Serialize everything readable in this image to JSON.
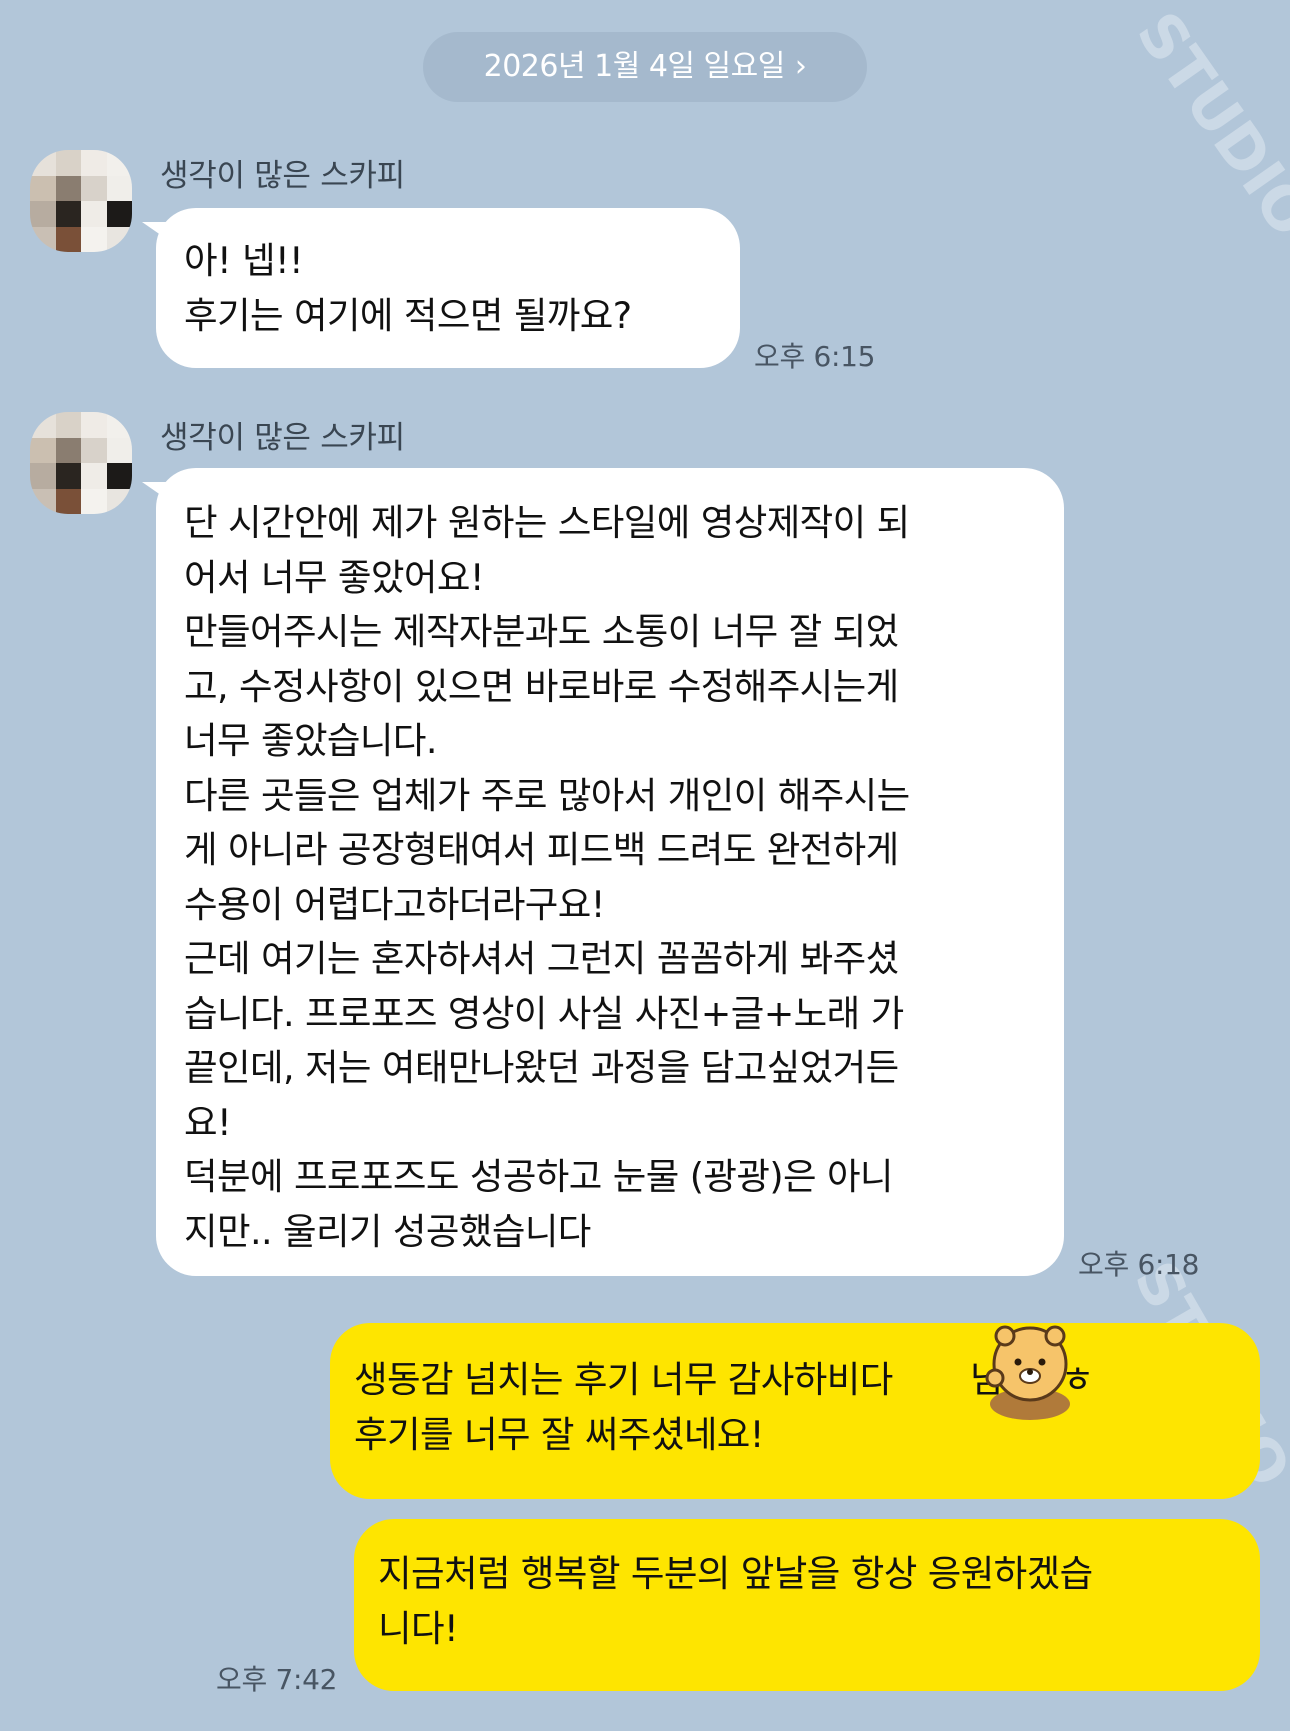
{
  "date_divider": {
    "label": "2026년 1월 4일 일요일",
    "chevron": "›"
  },
  "messages": [
    {
      "sender": "생각이 많은 스카피",
      "text": "아! 넵!!\n후기는 여기에 적으면 될까요?",
      "time": "오후 6:15"
    },
    {
      "sender": "생각이 많은 스카피",
      "text": "단 시간안에 제가 원하는 스타일에 영상제작이 되\n어서 너무 좋았어요!\n만들어주시는 제작자분과도 소통이 너무 잘 되었\n고, 수정사항이 있으면 바로바로 수정해주시는게\n너무 좋았습니다.\n다른 곳들은 업체가 주로 많아서 개인이 해주시는\n게 아니라 공장형태여서 피드백 드려도 완전하게\n수용이 어렵다고하더라구요!\n근데 여기는 혼자하셔서 그런지 꼼꼼하게 봐주셨\n습니다. 프로포즈 영상이 사실 사진+글+노래 가\n끝인데, 저는 여태만나왔던 과정을 담고싶었거든\n요!\n덕분에 프로포즈도 성공하고 눈물 (광광)은 아니\n지만.. 울리기 성공했습니다",
      "time": "오후 6:18"
    },
    {
      "text": "생동감 넘치는 후기 너무 감사하비다       님! ㅎㅎ\n후기를 너무 잘 써주셨네요!"
    },
    {
      "text": "지금처럼 행복할 두분의 앞날을 항상 응원하겠습\n니다!",
      "time": "오후 7:42"
    }
  ],
  "sticker": "lion-emoji-icon",
  "watermark_text": "STUDIO",
  "colors": {
    "background": "#b2c6d9",
    "incoming_bubble": "#ffffff",
    "outgoing_bubble": "#fee500"
  }
}
